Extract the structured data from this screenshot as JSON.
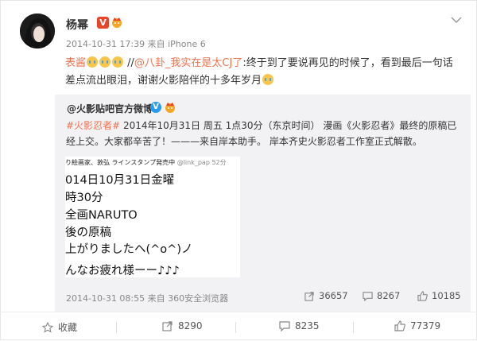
{
  "post": {
    "username": "杨幂",
    "meta": "2014-10-31 17:39 来自 iPhone 6",
    "text_a": "表酱",
    "text_b": "//",
    "text_c": "@八卦_我实在是太CJ了",
    "text_d": ":终于到了要说再见的时候了，看到最后一句话差点流出眼泪，谢谢火影陪伴的十多年岁月"
  },
  "repost": {
    "author": "@火影贴吧官方微博",
    "tag": "#火影忍者#",
    "text": " 2014年10月31日 周五 1点30分（东京时间） 漫画《火影忍者》最终的原稿已经上交。大家都辛苦了！———来自岸本助手。 岸本齐史火影忍者工作室正式解散。",
    "image": {
      "header_text": "り絵画家、敦弘 ラインスタンプ発売中",
      "header_handle": "@link_pap",
      "header_time": "52分",
      "lines": [
        "014日10月31日金曜",
        "時30分",
        "全画NARUTO",
        "後の原稿",
        "上がりましたヘ(^o^)ノ",
        "んなお疲れ様ーー♪♪♪"
      ]
    },
    "footer_meta": "2014-10-31 08:55 来自 360安全浏览器",
    "repost_count": "36657",
    "comment_count": "8267",
    "like_count": "10185"
  },
  "actions": {
    "favorite": "收藏",
    "repost": "8290",
    "comment": "8235",
    "like": "77379"
  },
  "colors": {
    "accent": "#eb7350",
    "verify_red": "#e8442a",
    "verify_blue": "#2a9bf0"
  }
}
